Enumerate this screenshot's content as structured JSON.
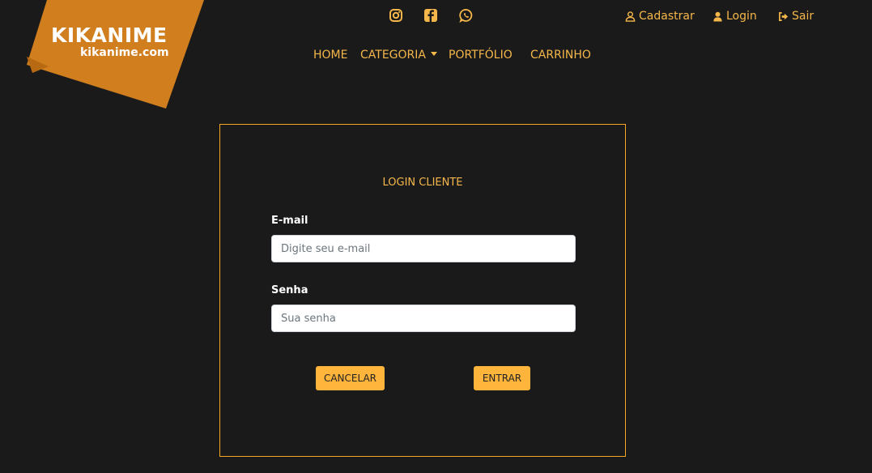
{
  "brand": {
    "name": "KIKANIME",
    "site": "kikanime.com",
    "color": "#d07e1e"
  },
  "social": [
    {
      "icon": "instagram-icon"
    },
    {
      "icon": "facebook-icon"
    },
    {
      "icon": "whatsapp-icon"
    }
  ],
  "auth": {
    "register": "Cadastrar",
    "login": "Login",
    "logout": "Sair"
  },
  "nav": {
    "home": "HOME",
    "category": "CATEGORIA",
    "portfolio": "PORTFÓLIO",
    "cart": "CARRINHO"
  },
  "form": {
    "title": "LOGIN CLIENTE",
    "email_label": "E-mail",
    "email_placeholder": "Digite seu e-mail",
    "password_label": "Senha",
    "password_placeholder": "Sua senha",
    "cancel": "CANCELAR",
    "submit": "ENTRAR"
  },
  "colors": {
    "accent": "#f5b74a",
    "button": "#ffb43c",
    "background": "#1b1a1b"
  }
}
